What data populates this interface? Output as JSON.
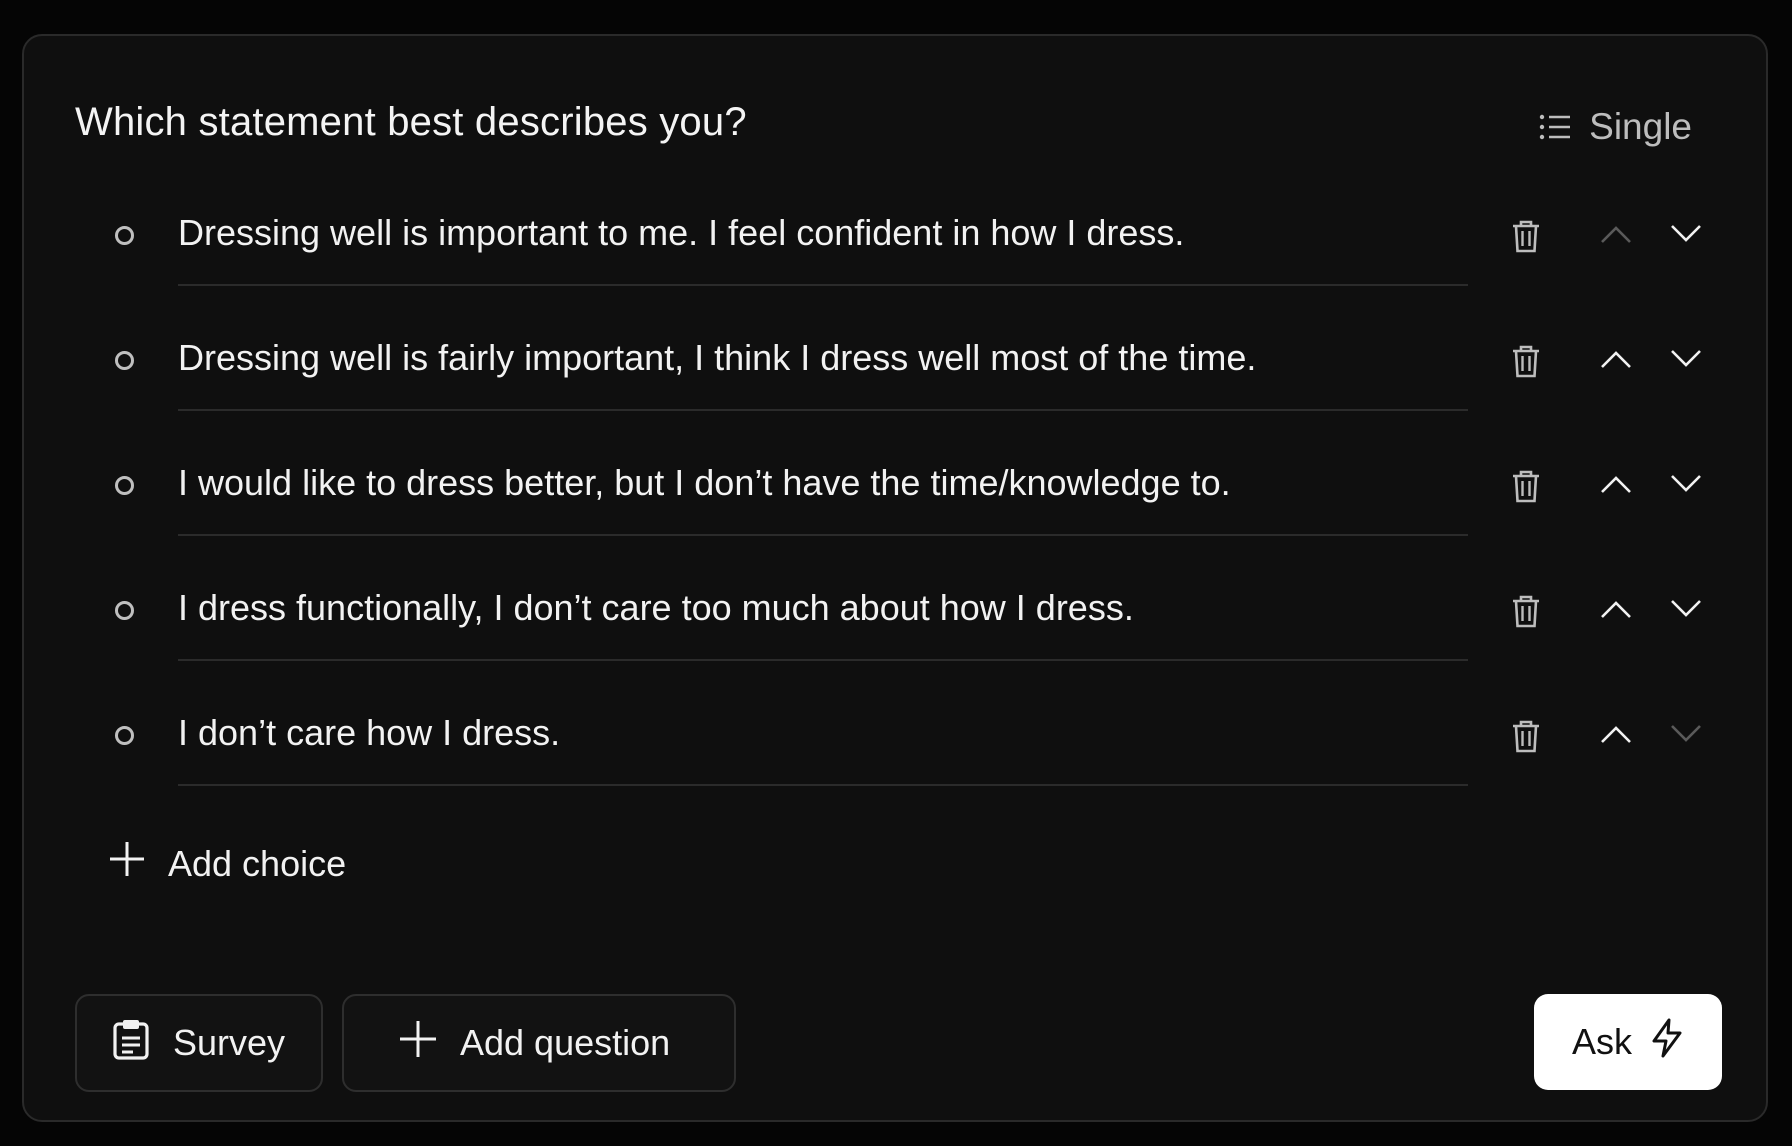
{
  "question": {
    "title": "Which statement best describes you?",
    "type_label": "Single"
  },
  "choices": [
    {
      "text": "Dressing well is important to me. I feel confident in how I dress.",
      "up_enabled": false,
      "down_enabled": true
    },
    {
      "text": "Dressing well is fairly important, I think I dress well most of the time.",
      "up_enabled": true,
      "down_enabled": true
    },
    {
      "text": "I would like to dress better, but I don’t have the time/knowledge to.",
      "up_enabled": true,
      "down_enabled": true
    },
    {
      "text": "I dress functionally, I don’t care too much about how I dress.",
      "up_enabled": true,
      "down_enabled": true
    },
    {
      "text": "I don’t care how I dress.",
      "up_enabled": true,
      "down_enabled": false
    }
  ],
  "add_choice_label": "Add choice",
  "footer": {
    "survey_label": "Survey",
    "add_question_label": "Add question",
    "ask_label": "Ask"
  },
  "colors": {
    "background": "#050505",
    "card": "#0f0f0f",
    "text": "#f2f2f2",
    "muted": "#bdbdbd",
    "disabled": "#5a5a5a",
    "ask_bg": "#ffffff"
  }
}
